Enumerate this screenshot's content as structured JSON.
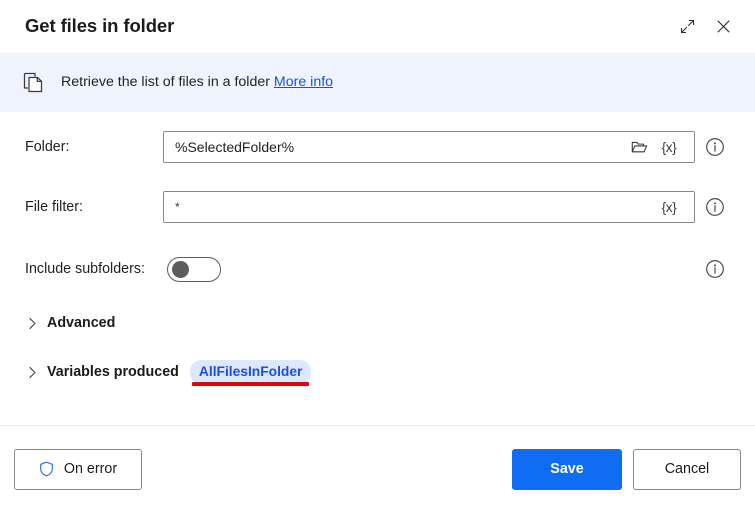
{
  "window": {
    "title": "Get files in folder",
    "expand_icon": "expand-diagonal-icon",
    "close_icon": "close-icon"
  },
  "banner": {
    "icon": "copy-files-icon",
    "text": "Retrieve the list of files in a folder",
    "link_label": "More info",
    "background_color": "#eff3fd",
    "link_color": "#1657d0"
  },
  "form": {
    "folder": {
      "label": "Folder:",
      "value": "%SelectedFolder%",
      "browse_icon": "folder-open-icon",
      "variable_label": "{x}",
      "info_icon": "info-icon"
    },
    "file_filter": {
      "label": "File filter:",
      "value": "*",
      "variable_label": "{x}",
      "info_icon": "info-icon"
    },
    "include_subfolders": {
      "label": "Include subfolders:",
      "state": "off",
      "info_icon": "info-icon"
    },
    "advanced": {
      "label": "Advanced",
      "expanded": "false",
      "chevron": "chevron-right-icon"
    },
    "variables_produced": {
      "label": "Variables produced",
      "expanded": "false",
      "chevron": "chevron-right-icon",
      "variable_name": "AllFilesInFolder",
      "pill_background": "#dce8fc",
      "pill_text_color": "#1a4fe0",
      "annotation_color": "#e8000d"
    }
  },
  "footer": {
    "on_error_label": "On error",
    "on_error_icon": "shield-icon",
    "save_label": "Save",
    "cancel_label": "Cancel",
    "primary_color": "#0f6cf3"
  }
}
